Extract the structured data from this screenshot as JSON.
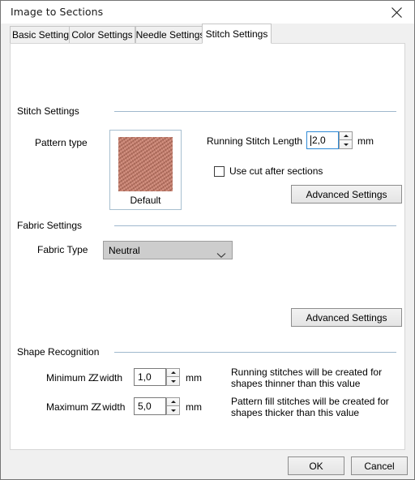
{
  "window": {
    "title": "Image to Sections",
    "close_icon": "close-icon"
  },
  "tabs": [
    {
      "label": "Basic Settings",
      "selected": false
    },
    {
      "label": "Color Settings",
      "selected": false
    },
    {
      "label": "Needle Settings",
      "selected": false
    },
    {
      "label": "Stitch Settings",
      "selected": true
    }
  ],
  "stitch_settings": {
    "group_label": "Stitch Settings",
    "pattern_type_label": "Pattern type",
    "pattern_name": "Default",
    "pattern_swatch_color": "#c87b68",
    "running_stitch_length_label": "Running Stitch Length",
    "running_stitch_length_value": "2,0",
    "running_stitch_length_unit": "mm",
    "use_cut_label": "Use cut after sections",
    "use_cut_checked": false,
    "advanced_settings_label": "Advanced Settings"
  },
  "fabric_settings": {
    "group_label": "Fabric Settings",
    "fabric_type_label": "Fabric Type",
    "fabric_type_value": "Neutral",
    "advanced_settings_label": "Advanced Settings"
  },
  "shape_recognition": {
    "group_label": "Shape Recognition",
    "min_zz_label_pre": "Minimum ",
    "min_zz_label_symbol": "ZZ",
    "min_zz_label_post": " width",
    "min_zz_value": "1,0",
    "min_zz_unit": "mm",
    "min_zz_description": "Running stitches will be created for shapes thinner than this value",
    "max_zz_label_pre": "Maximum ",
    "max_zz_label_symbol": "ZZ",
    "max_zz_label_post": " width",
    "max_zz_value": "5,0",
    "max_zz_unit": "mm",
    "max_zz_description": "Pattern fill stitches will be created for shapes thicker than this value"
  },
  "footer": {
    "ok_label": "OK",
    "cancel_label": "Cancel"
  },
  "colors": {
    "accent_rule": "#9fb8cd",
    "focus_border": "#2f8ad6",
    "dialog_bg": "#f0f0f0",
    "page_bg": "#ffffff"
  }
}
